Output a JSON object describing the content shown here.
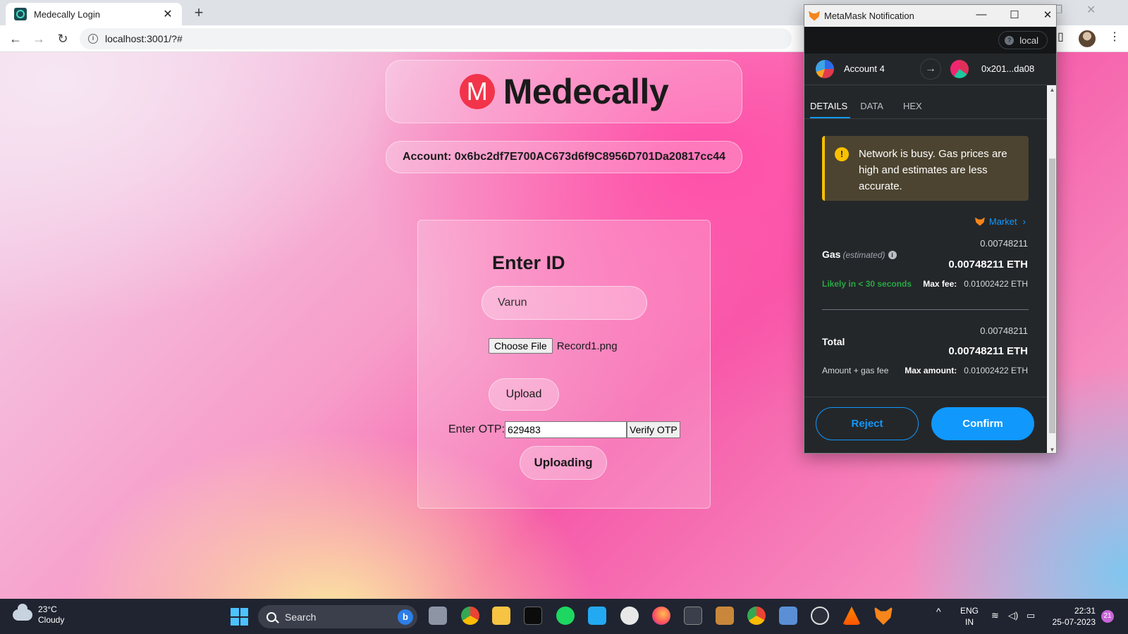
{
  "browser": {
    "tab_title": "Medecally Login",
    "url": "localhost:3001/?#"
  },
  "page": {
    "logo_letter": "M",
    "logo_text": "Medecally",
    "account_label": "Account: 0x6bc2df7E700AC673d6f9C8956D701Da20817cc44",
    "heading": "Enter ID",
    "name_value": "Varun",
    "choose_file_label": "Choose File",
    "file_name": "Record1.png",
    "upload_label": "Upload",
    "otp_label": "Enter OTP:",
    "otp_value": "629483",
    "verify_label": "Verify OTP",
    "uploading_label": "Uploading"
  },
  "metamask": {
    "window_title": "MetaMask Notification",
    "network": "local",
    "from_account": "Account 4",
    "to_address": "0x201...da08",
    "tabs": [
      "DETAILS",
      "DATA",
      "HEX"
    ],
    "warning": "Network is busy. Gas prices are high and estimates are less accurate.",
    "market_label": "Market",
    "gas_label": "Gas",
    "gas_estimated": "(estimated)",
    "gas_small": "0.00748211",
    "gas_big": "0.00748211 ETH",
    "likely": "Likely in < 30 seconds",
    "max_fee_label": "Max fee:",
    "max_fee_value": "0.01002422 ETH",
    "total_label": "Total",
    "total_small": "0.00748211",
    "total_big": "0.00748211 ETH",
    "amount_gas_label": "Amount + gas fee",
    "max_amount_label": "Max amount:",
    "max_amount_value": "0.01002422 ETH",
    "reject_label": "Reject",
    "confirm_label": "Confirm"
  },
  "taskbar": {
    "temperature": "23°C",
    "weather": "Cloudy",
    "search_label": "Search",
    "lang_top": "ENG",
    "lang_bottom": "IN",
    "time": "22:31",
    "date": "25-07-2023",
    "notification_count": "21"
  },
  "colors": {
    "accent": "#1098fc",
    "logo_red": "#f2344b",
    "warning": "#f8c000",
    "success": "#28a745"
  }
}
